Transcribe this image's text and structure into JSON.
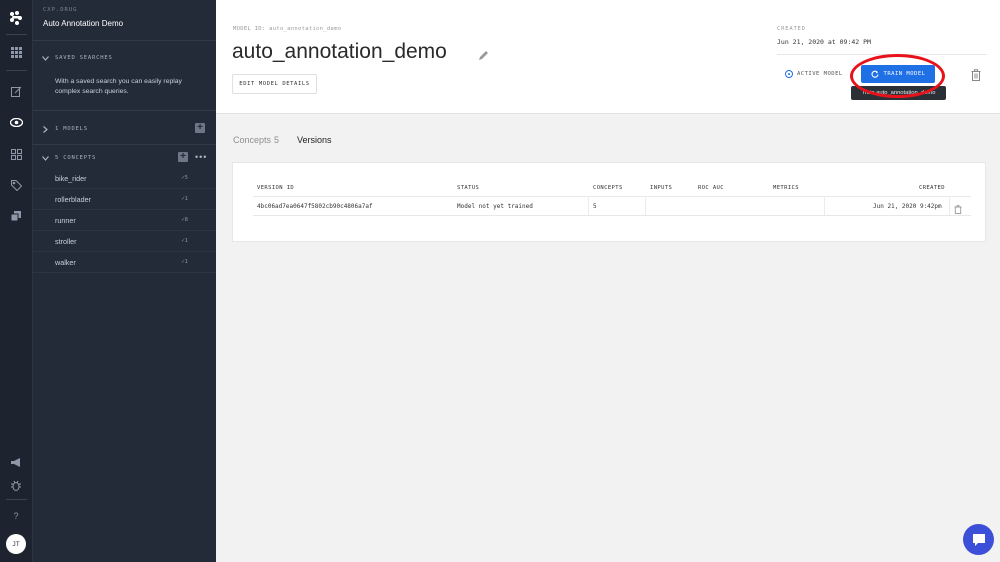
{
  "rail": {
    "avatar_initials": "JT",
    "icons": [
      "clarifai-logo-icon",
      "apps-grid-icon",
      "edit-icon",
      "eye-icon",
      "concepts-grid-icon",
      "tag-icon",
      "layers-icon",
      "megaphone-icon",
      "bug-icon",
      "help-icon"
    ]
  },
  "panel": {
    "app_subtitle": "CXP.DRUG",
    "app_title": "Auto Annotation Demo",
    "saved_searches_label": "SAVED SEARCHES",
    "saved_searches_desc": "With a saved search you can easily replay complex search queries.",
    "models_label": "1 MODELS",
    "concepts_label": "5 CONCEPTS",
    "concepts": [
      {
        "name": "bike_rider",
        "count": "✓5"
      },
      {
        "name": "rollerblader",
        "count": "✓1"
      },
      {
        "name": "runner",
        "count": "✓8"
      },
      {
        "name": "stroller",
        "count": "✓1"
      },
      {
        "name": "walker",
        "count": "✓1"
      }
    ]
  },
  "header": {
    "model_id": "MODEL ID: auto_annotation_demo",
    "title": "auto_annotation_demo",
    "edit_button": "EDIT MODEL DETAILS",
    "created_label": "CREATED",
    "created_value": "Jun 21, 2020 at 09:42 PM",
    "active_model_label": "ACTIVE MODEL",
    "train_button": "TRAIN MODEL",
    "tooltip": "Train auto_annotation_demo"
  },
  "tabs": {
    "concepts_label": "Concepts",
    "concepts_count": "5",
    "versions_label": "Versions"
  },
  "versions_table": {
    "headers": [
      "VERSION ID",
      "STATUS",
      "CONCEPTS",
      "INPUTS",
      "ROC AUC",
      "METRICS",
      "CREATED"
    ],
    "rows": [
      {
        "version_id": "4bc06ad7ea0647f5802cb90c4806a7af",
        "status": "Model not yet trained",
        "concepts": "5",
        "inputs": "",
        "roc_auc": "",
        "metrics": "",
        "created": "Jun 21, 2020 9:42pm"
      }
    ]
  },
  "colors": {
    "accent": "#1f6fe5",
    "sidebar": "#232b38",
    "highlight": "#e8131a"
  }
}
